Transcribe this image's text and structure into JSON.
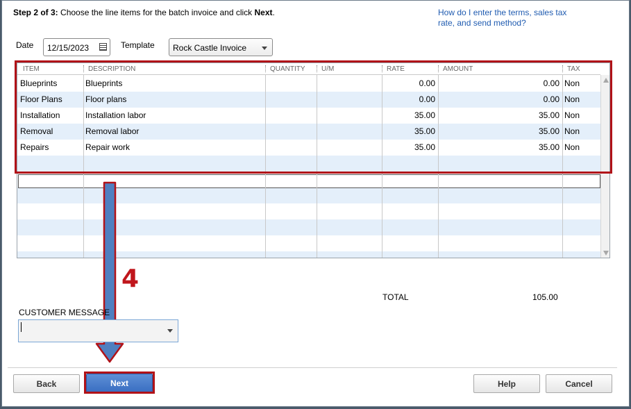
{
  "header": {
    "step_prefix": "Step 2 of 3:",
    "step_text": " Choose the line items for the batch invoice and click ",
    "step_next": "Next",
    "step_end": ".",
    "help_link": "How do I enter the terms, sales tax rate, and send method?"
  },
  "form": {
    "date_label": "Date",
    "date_value": "12/15/2023",
    "template_label": "Template",
    "template_value": "Rock Castle Invoice"
  },
  "grid": {
    "columns": [
      "ITEM",
      "DESCRIPTION",
      "QUANTITY",
      "U/M",
      "RATE",
      "AMOUNT",
      "TAX"
    ],
    "rows": [
      {
        "item": "Blueprints",
        "description": "Blueprints",
        "quantity": "",
        "um": "",
        "rate": "0.00",
        "amount": "0.00",
        "tax": "Non"
      },
      {
        "item": "Floor Plans",
        "description": "Floor plans",
        "quantity": "",
        "um": "",
        "rate": "0.00",
        "amount": "0.00",
        "tax": "Non"
      },
      {
        "item": "Installation",
        "description": "Installation labor",
        "quantity": "",
        "um": "",
        "rate": "35.00",
        "amount": "35.00",
        "tax": "Non"
      },
      {
        "item": "Removal",
        "description": "Removal labor",
        "quantity": "",
        "um": "",
        "rate": "35.00",
        "amount": "35.00",
        "tax": "Non"
      },
      {
        "item": "Repairs",
        "description": "Repair work",
        "quantity": "",
        "um": "",
        "rate": "35.00",
        "amount": "35.00",
        "tax": "Non"
      }
    ]
  },
  "totals": {
    "total_label": "TOTAL",
    "total_value": "105.00"
  },
  "customer_message": {
    "label": "CUSTOMER MESSAGE",
    "value": ""
  },
  "annotation": {
    "step_number": "4"
  },
  "buttons": {
    "back": "Back",
    "next": "Next",
    "help": "Help",
    "cancel": "Cancel"
  },
  "colors": {
    "highlight_red": "#b11218",
    "row_alt": "#e4effa",
    "link": "#1f5bb0",
    "arrow_blue": "#4f7fc0"
  }
}
